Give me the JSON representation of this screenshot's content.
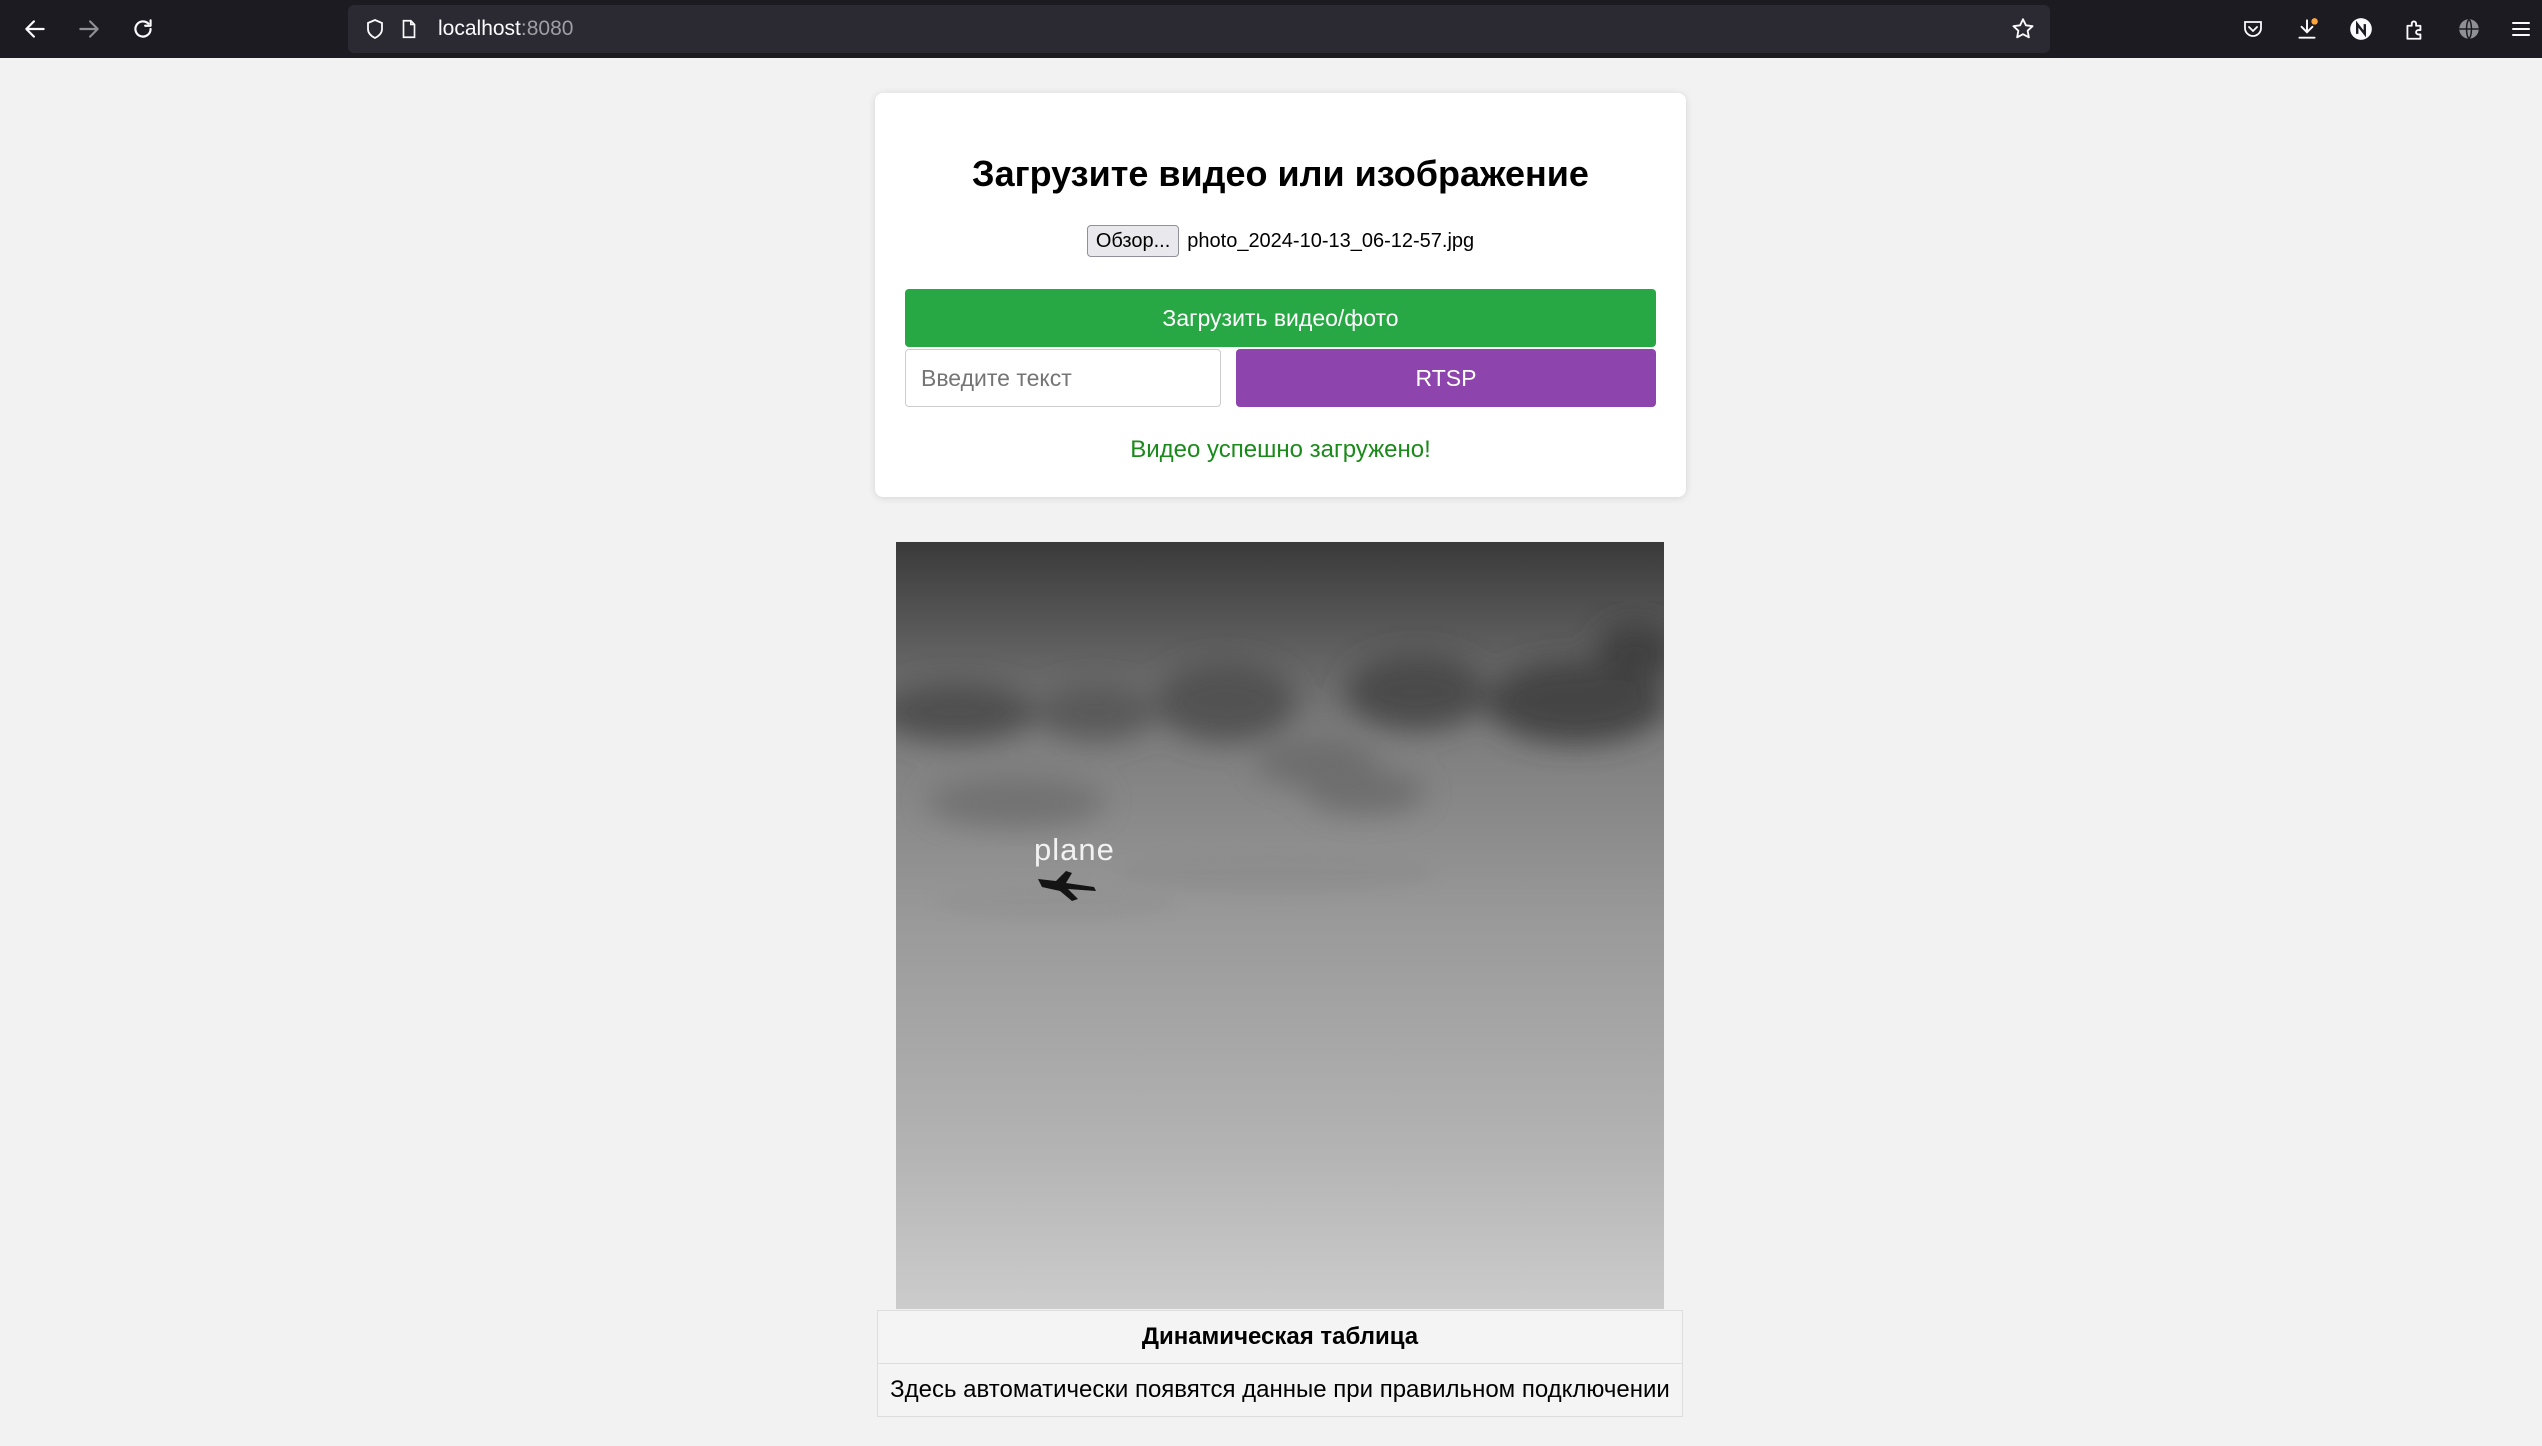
{
  "browser": {
    "url_host": "localhost",
    "url_port": ":8080"
  },
  "upload": {
    "title": "Загрузите видео или изображение",
    "browse_label": "Обзор...",
    "file_name": "photo_2024-10-13_06-12-57.jpg",
    "upload_button": "Загрузить видео/фото",
    "text_placeholder": "Введите текст",
    "text_value": "",
    "rtsp_button": "RTSP",
    "status": "Видео успешно загружено!",
    "colors": {
      "upload": "#28a745",
      "rtsp": "#8e44ad",
      "status": "#1a8a1a"
    }
  },
  "result": {
    "detection_label": "plane"
  },
  "table": {
    "header": "Динамическая таблица",
    "row": "Здесь автоматически появятся данные при правильном подключении"
  }
}
